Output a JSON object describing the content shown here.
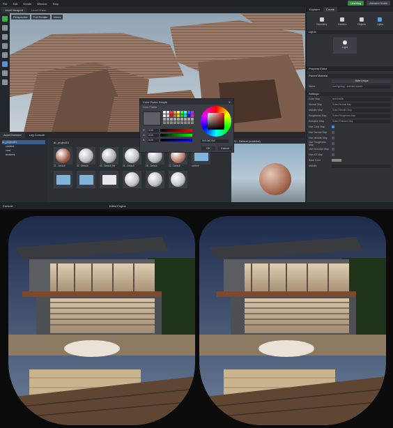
{
  "menu": [
    "File",
    "Edit",
    "Create",
    "Window",
    "Help"
  ],
  "account": {
    "learning": "Learning",
    "user": "Alexand Smith"
  },
  "viewport_tabs": [
    "Level Viewport",
    "Level Vhew"
  ],
  "viewport_toolbar": [
    "Perspective",
    "Full Render",
    "Views"
  ],
  "color_picker": {
    "title": "Color Picker Simple",
    "sub": "Color Palette",
    "r": "0.00",
    "g": "0.00",
    "b": "0.00",
    "hex": "0x0 0x0 0x0",
    "ok": "OK",
    "cancel": "Cancel",
    "colors": {
      "swatch": "#5d6066"
    }
  },
  "explorer": {
    "tabs": [
      "Explorer",
      "Create"
    ],
    "create_items": [
      "Geometry",
      "Camera",
      "Objects",
      "Lights"
    ],
    "lights_header": "Lights",
    "light_tile": "Light"
  },
  "property_editor": {
    "title": "Property Editor",
    "section_parent": "Parent Material",
    "make_unique": "Make Unique",
    "name_label": "Name",
    "name_value": "core/lighting/...standard.shader",
    "section_settings": "Settings",
    "rows": [
      {
        "label": "Color Map",
        "value": "textures/tile"
      },
      {
        "label": "Normal Map",
        "value": "Select Normal Map"
      },
      {
        "label": "Metallic Map",
        "value": "Select Metallic Map"
      },
      {
        "label": "Roughness Map",
        "value": "Select Roughness Map"
      },
      {
        "label": "Emissive Map",
        "value": "Select Emissive Map"
      },
      {
        "label": "Use Color Map",
        "value": ""
      },
      {
        "label": "Use Normal Map",
        "value": ""
      },
      {
        "label": "Use Metallic Map",
        "value": ""
      },
      {
        "label": "Use Roughness Map",
        "value": ""
      },
      {
        "label": "Use Emissive Map",
        "value": ""
      },
      {
        "label": "Use AO Map",
        "value": ""
      },
      {
        "label": "Base Color",
        "value": ""
      },
      {
        "label": "Metallic",
        "value": ""
      }
    ]
  },
  "bottom_tabs": [
    "Asset Browser",
    "Log Console",
    "Asset Preview"
  ],
  "tree": [
    "ar_project01",
    "content",
    "core",
    "textures"
  ],
  "asset_path": "ar_project01",
  "assets": [
    {
      "name": "01 - Default",
      "kind": "ball",
      "color": "#9a5a3f"
    },
    {
      "name": "02 - Default",
      "kind": "ball",
      "color": "#b8b8b8"
    },
    {
      "name": "03 - Default_tile",
      "kind": "ball",
      "color": "#b0b0b0"
    },
    {
      "name": "04 - Default",
      "kind": "ball",
      "color": "#bdbdbd"
    },
    {
      "name": "05 - Default",
      "kind": "ball",
      "color": "#b6b6b6"
    },
    {
      "name": "22 - Default",
      "kind": "ball",
      "color": "#b57a63"
    },
    {
      "name": "content",
      "kind": "folder",
      "color": "#7fb3d9"
    },
    {
      "name": "",
      "kind": "folder",
      "color": "#7fb3d9"
    },
    {
      "name": "",
      "kind": "folder",
      "color": "#7fb3d9"
    },
    {
      "name": "",
      "kind": "file",
      "color": "#e8e8e8"
    },
    {
      "name": "",
      "kind": "ball",
      "color": "#c0c0c0"
    },
    {
      "name": "",
      "kind": "ball",
      "color": "#bbbbbb"
    },
    {
      "name": "",
      "kind": "ball",
      "color": "#c3c3c3"
    }
  ],
  "preview": {
    "title": "22 - Default (material)"
  },
  "status": [
    "Console",
    "Editor Engine"
  ]
}
